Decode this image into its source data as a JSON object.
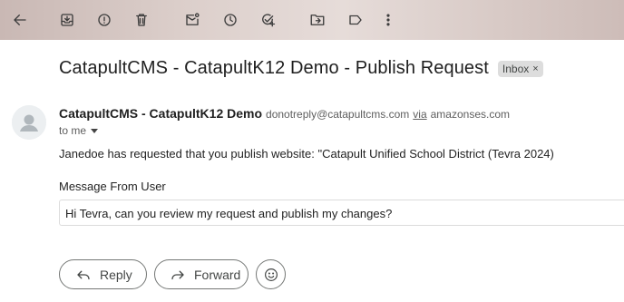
{
  "toolbar": {
    "icons": [
      "back-arrow-icon",
      "archive-icon",
      "report-spam-icon",
      "delete-icon",
      "mark-unread-icon",
      "snooze-icon",
      "add-task-icon",
      "move-to-icon",
      "labels-icon",
      "more-vert-icon"
    ]
  },
  "email": {
    "subject": "CatapultCMS - CatapultK12 Demo - Publish Request",
    "label": "Inbox",
    "label_close": "×",
    "sender_name": "CatapultCMS - CatapultK12 Demo",
    "sender_email": "donotreply@catapultcms.com",
    "via_text": "via",
    "via_domain": "amazonses.com",
    "to_text": "to me",
    "body_line": "Janedoe has requested that you publish website: \"Catapult Unified School District (Tevra 2024)",
    "message_label": "Message From User",
    "message_value": "Hi Tevra, can you review my request and publish my changes?"
  },
  "actions": {
    "reply_label": "Reply",
    "forward_label": "Forward"
  }
}
